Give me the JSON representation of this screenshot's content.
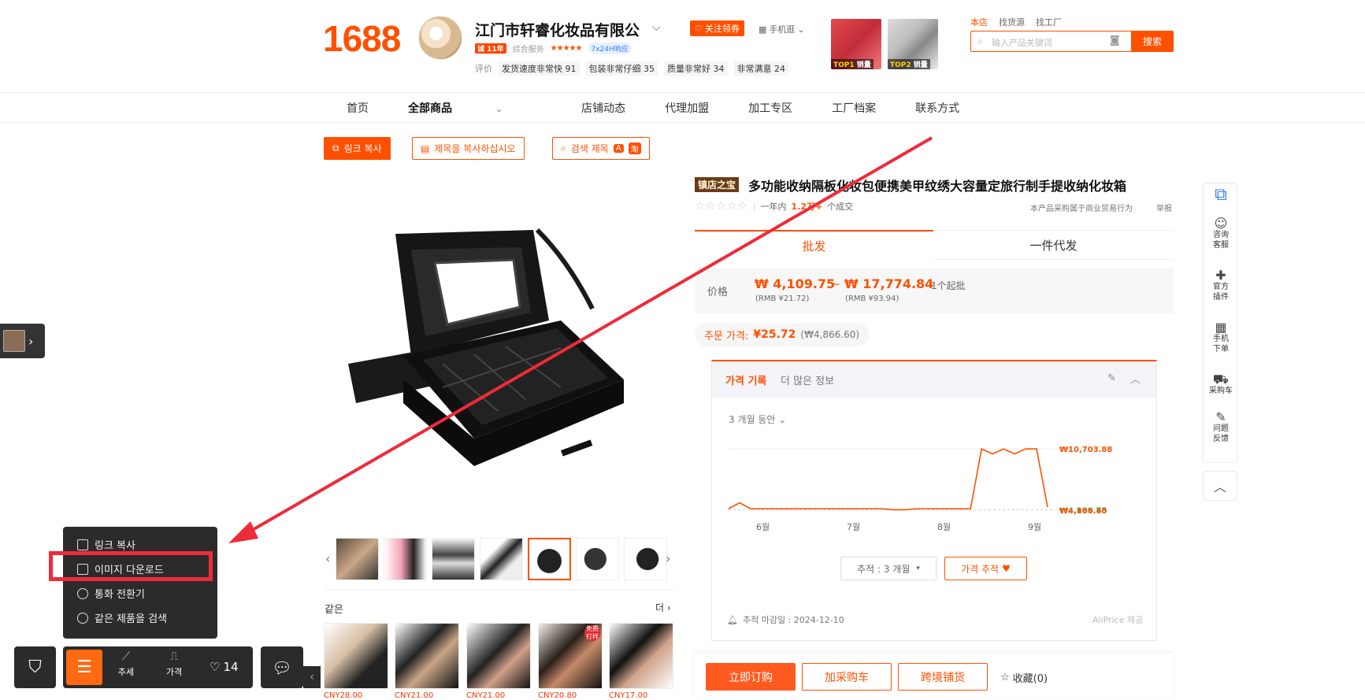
{
  "header": {
    "logo": "1688",
    "shop_name": "江门市轩睿化妆品有限公",
    "shop_badge": "诚 11年",
    "overall_label": "综合服务",
    "service_badge": "7x24H响应",
    "eval_label": "评价",
    "evals": [
      "发货速度非常快 91",
      "包装非常仔细 35",
      "质量非常好 34",
      "非常满意 24"
    ],
    "follow_label": "关注领券",
    "mobile_label": "手机逛",
    "top_products": [
      {
        "rank": "TOP1",
        "label": "销量"
      },
      {
        "rank": "TOP2",
        "label": "销量"
      }
    ],
    "search_tabs": [
      "本店",
      "找货源",
      "找工厂"
    ],
    "search_placeholder": "输入产品关键词",
    "search_button": "搜索"
  },
  "nav": [
    "首页",
    "全部商品",
    "店铺动态",
    "代理加盟",
    "加工专区",
    "工厂档案",
    "联系方式"
  ],
  "toolbar_actions": {
    "copy_link": "링크 복사",
    "copy_title": "제목을 복사하십시오",
    "search_title": "검색 제목"
  },
  "gallery": {
    "same_title": "같은",
    "more": "더",
    "same_prices": [
      "CNY28.00",
      "CNY21.00",
      "CNY21.00",
      "CNY20.80",
      "CNY17.00"
    ],
    "same_badge": "免费打样"
  },
  "product": {
    "tag": "镇店之宝",
    "title": "多功能收纳隔板化妆包便携美甲纹绣大容量定旅行制手提收纳化妆箱",
    "year_label": "一年内",
    "sold": "1.2万+",
    "sold_suffix": "个成交",
    "biz_note": "本产品采购属于商业贸易行为",
    "report": "举报",
    "tab_wholesale": "批发",
    "tab_dropship": "一件代发",
    "price_label": "价格",
    "price_low": "₩ 4,109.75",
    "price_low_rmb": "(RMB ¥21.72)",
    "price_high": "₩ 17,774.84",
    "price_high_rmb": "(RMB ¥93.94)",
    "price_tilde": "~",
    "min_order": "1个起批",
    "order_price_label": "주문 가격:",
    "order_price": "¥25.72",
    "order_price_krw": "(₩4,866.60)"
  },
  "price_history": {
    "tab_on": "가격 기록",
    "tab_off": "더 많은 정보",
    "range": "3 개월 동안",
    "track_select": "추적 : 3 개월",
    "track_button": "가격 추적",
    "deadline": "추적 마감일 : 2024-12-10",
    "provider": "AliPrice 제공",
    "accent": "#ff5000"
  },
  "chart_data": {
    "type": "line",
    "x_ticks": [
      "6월",
      "7월",
      "8월",
      "9월"
    ],
    "series": [
      {
        "values": [
          4700,
          5300,
          4700,
          4700,
          4700,
          4700,
          4700,
          4700,
          4700,
          4700,
          4700,
          4700,
          4700,
          4700,
          4700,
          4600,
          4600,
          4700,
          4700,
          4700,
          4700,
          4700,
          4700,
          10703.88,
          10200,
          10703.88,
          10200,
          10703.88,
          10703.88,
          4866.6
        ]
      }
    ],
    "max_label": "₩10,703.88",
    "min_label": "₩4,109.75",
    "current_label": "₩4,866.60",
    "ylim": [
      4000,
      11500
    ],
    "grid": false
  },
  "buy": {
    "buy_now": "立即订购",
    "add_cart": "加采购车",
    "cross_border": "跨境铺货",
    "fav": "收藏(0)"
  },
  "side": {
    "consult": "咨询\n客服",
    "plugin": "官方\n插件",
    "mobile": "手机\n下单",
    "cart": "采购车",
    "feedback": "问题\n反馈"
  },
  "context_menu": {
    "items": [
      "링크 복사",
      "이미지 다운로드",
      "통화 전환기",
      "같은 제품을 검색"
    ]
  },
  "bottom_toolbar": {
    "trend": "추세",
    "price": "가격",
    "likes": "14"
  }
}
